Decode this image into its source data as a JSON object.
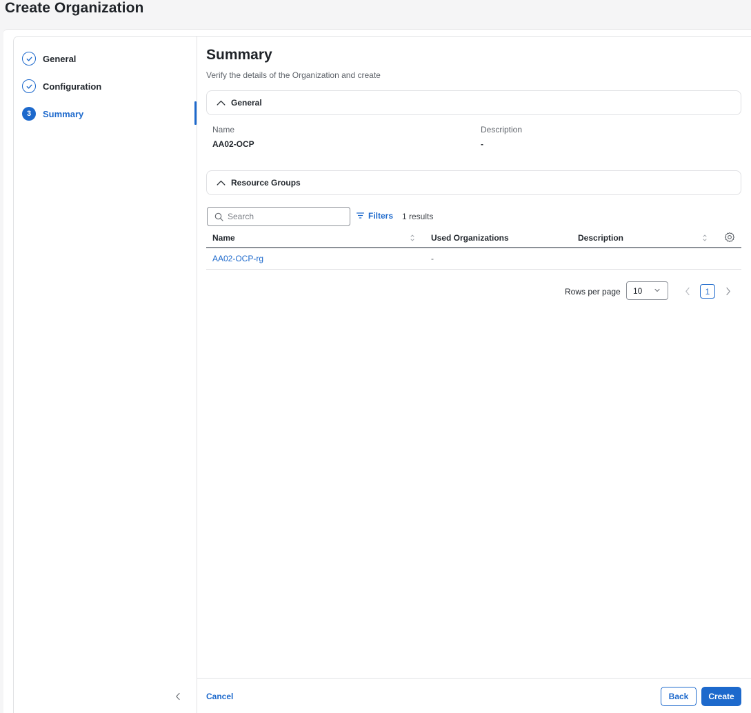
{
  "page": {
    "title": "Create Organization"
  },
  "steps": [
    {
      "number": "",
      "label": "General",
      "state": "complete"
    },
    {
      "number": "",
      "label": "Configuration",
      "state": "complete"
    },
    {
      "number": "3",
      "label": "Summary",
      "state": "active"
    }
  ],
  "main": {
    "title": "Summary",
    "subtitle": "Verify the details of the Organization and create"
  },
  "general_section": {
    "header": "General",
    "fields": [
      {
        "label": "Name",
        "value": "AA02-OCP"
      },
      {
        "label": "Description",
        "value": "-"
      }
    ]
  },
  "resource_groups": {
    "header": "Resource Groups",
    "search_placeholder": "Search",
    "filters_label": "Filters",
    "results_text": "1 results",
    "columns": [
      "Name",
      "Used Organizations",
      "Description"
    ],
    "rows": [
      {
        "name": "AA02-OCP-rg",
        "used_organizations": "-",
        "description": ""
      }
    ],
    "pagination": {
      "rows_per_page_label": "Rows per page",
      "rows_per_page": "10",
      "current_page": "1"
    }
  },
  "footer": {
    "cancel_label": "Cancel",
    "back_label": "Back",
    "create_label": "Create"
  },
  "colors": {
    "accent": "#1d69cc",
    "border": "#dfe0e3"
  }
}
